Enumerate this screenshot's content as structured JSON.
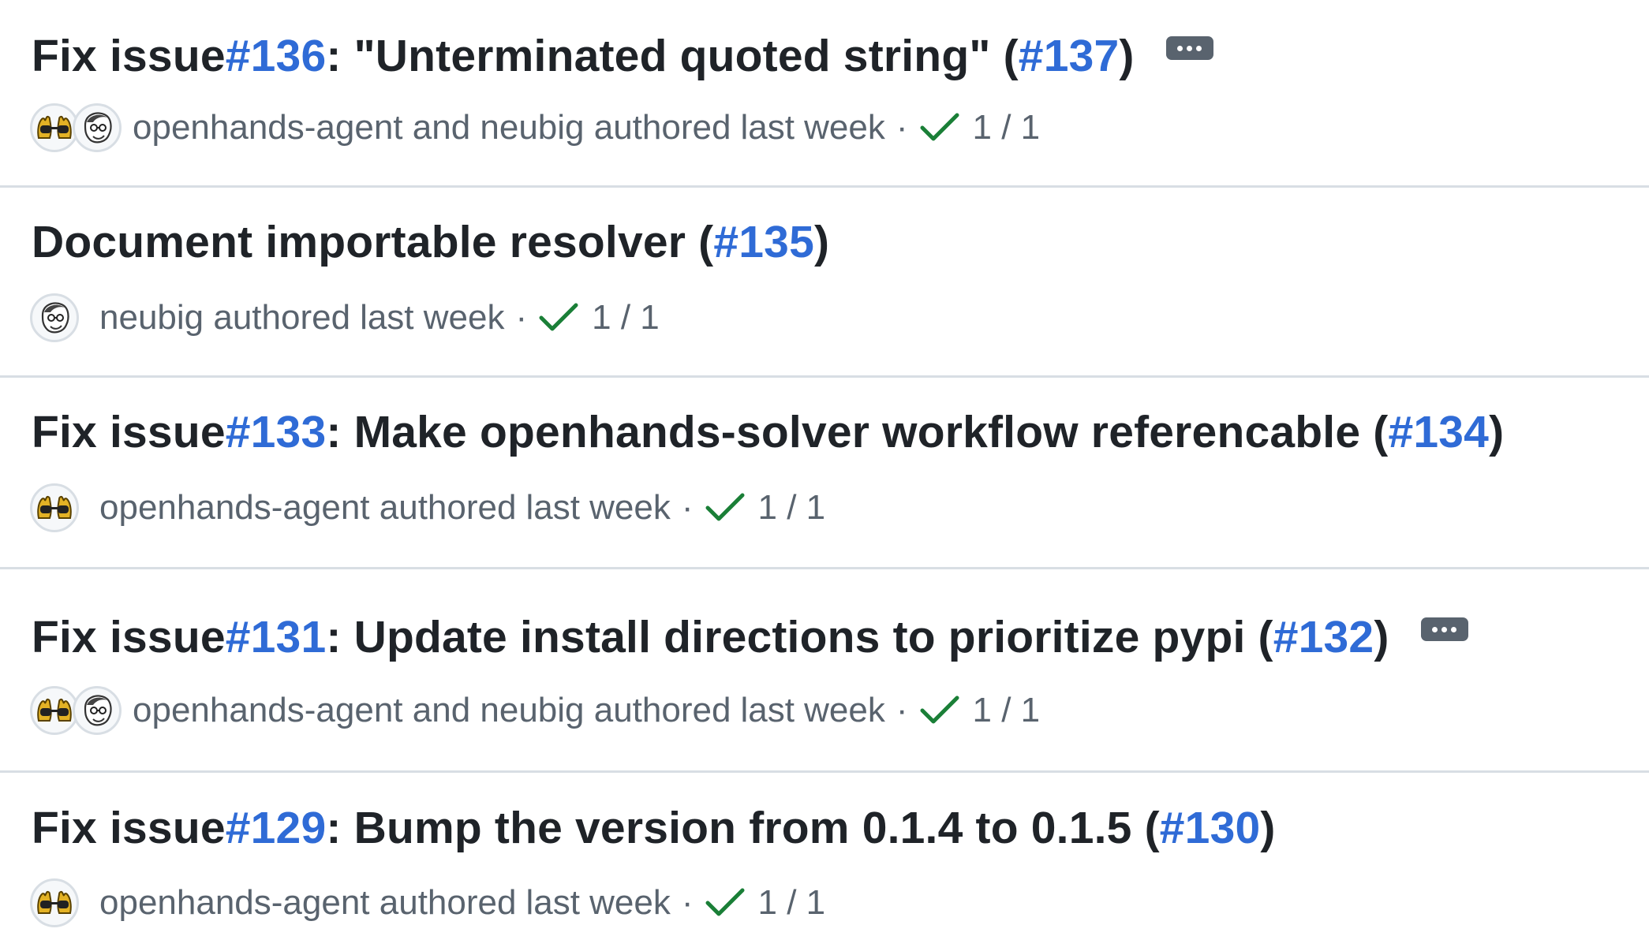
{
  "commits": [
    {
      "title_prefix": "Fix issue ",
      "issue_ref": "#136",
      "title_main": ": \"Unterminated quoted string\" (",
      "pr_ref": "#137",
      "title_suffix": ")",
      "has_more_button": true,
      "authors_text": "openhands-agent and neubig authored",
      "time": "last week",
      "separator": "·",
      "checks": "1 / 1",
      "avatars": [
        "openhands-agent-avatar",
        "neubig-avatar"
      ]
    },
    {
      "title_prefix": "Document importable resolver (",
      "issue_ref": "",
      "title_main": "",
      "pr_ref": "#135",
      "title_suffix": ")",
      "has_more_button": false,
      "authors_text": "neubig authored",
      "time": "last week",
      "separator": "·",
      "checks": "1 / 1",
      "avatars": [
        "neubig-avatar"
      ]
    },
    {
      "title_prefix": "Fix issue ",
      "issue_ref": "#133",
      "title_main": ": Make openhands-solver workflow referencable (",
      "pr_ref": "#134",
      "title_suffix": ")",
      "has_more_button": false,
      "authors_text": "openhands-agent authored",
      "time": "last week",
      "separator": "·",
      "checks": "1 / 1",
      "avatars": [
        "openhands-agent-avatar"
      ]
    },
    {
      "title_prefix": "Fix issue ",
      "issue_ref": "#131",
      "title_main": ": Update install directions to prioritize pypi (",
      "pr_ref": "#132",
      "title_suffix": ")",
      "has_more_button": true,
      "authors_text": "openhands-agent and neubig authored",
      "time": "last week",
      "separator": "·",
      "checks": "1 / 1",
      "avatars": [
        "openhands-agent-avatar",
        "neubig-avatar"
      ]
    },
    {
      "title_prefix": "Fix issue ",
      "issue_ref": "#129",
      "title_main": ": Bump the version from 0.1.4 to 0.1.5 (",
      "pr_ref": "#130",
      "title_suffix": ")",
      "has_more_button": false,
      "authors_text": "openhands-agent authored",
      "time": "last week",
      "separator": "·",
      "checks": "1 / 1",
      "avatars": [
        "openhands-agent-avatar"
      ]
    }
  ],
  "colors": {
    "link": "#2f6bd6",
    "text": "#1f2328",
    "muted": "#59636e",
    "success": "#1a7f37",
    "divider": "#d8dee4"
  }
}
